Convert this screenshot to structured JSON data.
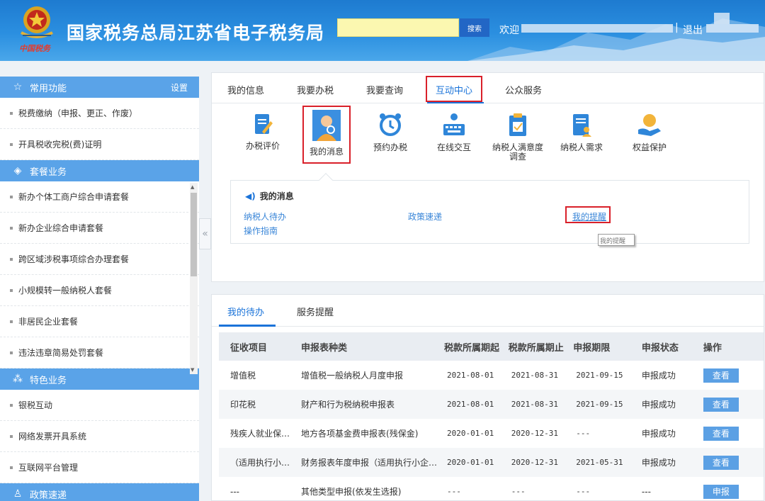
{
  "header": {
    "title": "国家税务总局江苏省电子税务局",
    "brand_sub": "中国税务",
    "search_placeholder": "",
    "search_button": "搜索",
    "welcome": "欢迎",
    "separator": "|",
    "logout": "退出"
  },
  "sidebar": {
    "sections": [
      {
        "title": "常用功能",
        "icon": "star-icon",
        "setting": "设置",
        "items": [
          "税费缴纳（申报、更正、作废）",
          "开具税收完税(费)证明"
        ]
      },
      {
        "title": "套餐业务",
        "icon": "layers-icon",
        "items": [
          "新办个体工商户综合申请套餐",
          "新办企业综合申请套餐",
          "跨区域涉税事项综合办理套餐",
          "小规模转一般纳税人套餐",
          "非居民企业套餐",
          "违法违章简易处罚套餐"
        ]
      },
      {
        "title": "特色业务",
        "icon": "grid-icon",
        "items": [
          "银税互动",
          "网络发票开具系统",
          "互联网平台管理"
        ]
      },
      {
        "title": "政策速递",
        "icon": "user-icon",
        "items": []
      }
    ],
    "collapse_icon": "«"
  },
  "main": {
    "tabs": [
      "我的信息",
      "我要办税",
      "我要查询",
      "互动中心",
      "公众服务"
    ],
    "active_tab": "互动中心",
    "icons": [
      {
        "label": "办税评价",
        "icon": "document-edit-icon"
      },
      {
        "label": "我的消息",
        "icon": "user-avatar-icon"
      },
      {
        "label": "预约办税",
        "icon": "alarm-clock-icon"
      },
      {
        "label": "在线交互",
        "icon": "keyboard-globe-icon"
      },
      {
        "label": "纳税人满意度调查",
        "icon": "clipboard-icon"
      },
      {
        "label": "纳税人需求",
        "icon": "document-person-icon"
      },
      {
        "label": "权益保护",
        "icon": "hand-globe-icon"
      }
    ],
    "messages": {
      "title": "我的消息",
      "links": {
        "pending": "纳税人待办",
        "policy": "政策速递",
        "reminder": "我的提醒",
        "guide": "操作指南"
      },
      "tooltip": "我的提醒"
    }
  },
  "todo": {
    "tabs": [
      "我的待办",
      "服务提醒"
    ],
    "columns": [
      "征收项目",
      "申报表种类",
      "税款所属期起",
      "税款所属期止",
      "申报期限",
      "申报状态",
      "操作"
    ],
    "rows": [
      [
        "增值税",
        "增值税一般纳税人月度申报",
        "2021-08-01",
        "2021-08-31",
        "2021-09-15",
        "申报成功",
        "查看"
      ],
      [
        "印花税",
        "财产和行为税纳税申报表",
        "2021-08-01",
        "2021-08-31",
        "2021-09-15",
        "申报成功",
        "查看"
      ],
      [
        "残疾人就业保…",
        "地方各项基金费申报表(残保金)",
        "2020-01-01",
        "2020-12-31",
        "---",
        "申报成功",
        "查看"
      ],
      [
        "（适用执行小…",
        "财务报表年度申报（适用执行小企…",
        "2020-01-01",
        "2020-12-31",
        "2021-05-31",
        "申报成功",
        "查看"
      ],
      [
        "---",
        "其他类型申报(依发生选报)",
        "---",
        "---",
        "---",
        "---",
        "申报"
      ]
    ]
  }
}
